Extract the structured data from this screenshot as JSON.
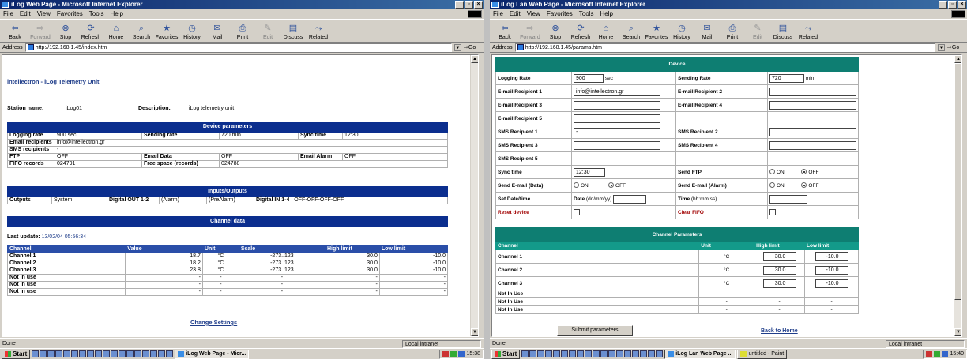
{
  "window1": {
    "title": "iLog Web Page - Microsoft Internet Explorer",
    "menu": [
      "File",
      "Edit",
      "View",
      "Favorites",
      "Tools",
      "Help"
    ],
    "toolbar": [
      {
        "label": "Back",
        "icon": "back-arrow-icon",
        "enabled": true
      },
      {
        "label": "Forward",
        "icon": "forward-arrow-icon",
        "enabled": false
      },
      {
        "label": "Stop",
        "icon": "stop-icon",
        "enabled": true
      },
      {
        "label": "Refresh",
        "icon": "refresh-icon",
        "enabled": true
      },
      {
        "label": "Home",
        "icon": "home-icon",
        "enabled": true
      },
      {
        "label": "Search",
        "icon": "search-icon",
        "enabled": true
      },
      {
        "label": "Favorites",
        "icon": "favorites-icon",
        "enabled": true
      },
      {
        "label": "History",
        "icon": "history-icon",
        "enabled": true
      },
      {
        "label": "Mail",
        "icon": "mail-icon",
        "enabled": true
      },
      {
        "label": "Print",
        "icon": "print-icon",
        "enabled": true
      },
      {
        "label": "Edit",
        "icon": "edit-icon",
        "enabled": false
      },
      {
        "label": "Discuss",
        "icon": "discuss-icon",
        "enabled": true
      },
      {
        "label": "Related",
        "icon": "related-icon",
        "enabled": true
      }
    ],
    "address_label": "Address",
    "address": "http://192.168.1.45/index.htm",
    "go_label": "Go",
    "status": "Done",
    "zone": "Local intranet",
    "page": {
      "heading": "intellectron - iLog Telemetry Unit",
      "station_label": "Station name:",
      "station_value": "iLog01",
      "desc_label": "Description:",
      "desc_value": "iLog telemetry unit",
      "device_title": "Device parameters",
      "logging_rate_label": "Logging rate",
      "logging_rate_value": "900 sec",
      "sending_rate_label": "Sending rate",
      "sending_rate_value": "720 min",
      "sync_label": "Sync time",
      "sync_value": "12:30",
      "email_recipients_label": "Email recipients",
      "email_recipients_value": "info@intellectron.gr",
      "sms_label": "SMS recipients",
      "sms_value": "-",
      "ftp_label": "FTP",
      "ftp_value": "OFF",
      "email_data_label": "Email Data",
      "email_data_value": "OFF",
      "email_alarm_label": "Email Alarm",
      "email_alarm_value": "OFF",
      "fifo_label": "FIFO records",
      "fifo_value": "024791",
      "free_label": "Free space (records)",
      "free_value": "024788",
      "io_title": "Inputs/Outputs",
      "outputs_label": "Outputs",
      "outputs_value": "System",
      "dout_label": "Digital OUT 1-2",
      "dout_v1": "(Alarm)",
      "dout_v2": "(PreAlarm)",
      "din_label": "Digital IN 1-4",
      "din_value": "OFF-OFF-OFF-OFF",
      "channel_title": "Channel data",
      "last_update_label": "Last update:",
      "last_update_value": "13/02/04 05:56:34",
      "columns": [
        "Channel",
        "Value",
        "Unit",
        "Scale",
        "High limit",
        "Low limit"
      ],
      "rows": [
        [
          "Channel 1",
          "18.7",
          "°C",
          "-273..123",
          "30.0",
          "-10.0"
        ],
        [
          "Channel 2",
          "18.2",
          "°C",
          "-273..123",
          "30.0",
          "-10.0"
        ],
        [
          "Channel 3",
          "23.8",
          "°C",
          "-273..123",
          "30.0",
          "-10.0"
        ],
        [
          "Not in use",
          "-",
          "-",
          "-",
          "-",
          "-"
        ],
        [
          "Not in use",
          "-",
          "-",
          "-",
          "-",
          "-"
        ],
        [
          "Not in use",
          "-",
          "-",
          "-",
          "-",
          "-"
        ]
      ],
      "change_link": "Change Settings"
    }
  },
  "window2": {
    "title": "iLog Lan Web Page - Microsoft Internet Explorer",
    "address": "http://192.168.1.45/params.htm",
    "status": "Done",
    "zone": "Local intranet",
    "page": {
      "device_title": "Device",
      "logging_rate_label": "Logging Rate",
      "logging_rate_value": "900",
      "logging_rate_unit": "sec",
      "sending_rate_label": "Sending Rate",
      "sending_rate_value": "720",
      "sending_rate_unit": "min",
      "email1_label": "E-mail Recipient 1",
      "email1_value": "info@intellectron.gr",
      "email2_label": "E-mail Recipient 2",
      "email3_label": "E-mail Recipient 3",
      "email4_label": "E-mail Recipient 4",
      "email5_label": "E-mail Recipient 5",
      "sms1_label": "SMS Recipient 1",
      "sms1_value": "-",
      "sms2_label": "SMS Recipient 2",
      "sms3_label": "SMS Recipient 3",
      "sms4_label": "SMS Recipient 4",
      "sms5_label": "SMS Recipient 5",
      "sync_label": "Sync time",
      "sync_value": "12:30",
      "ftp_label": "Send FTP",
      "on_label": "ON",
      "off_label": "OFF",
      "email_data_label": "Send E-mail (Data)",
      "email_alarm_label": "Send E-mail (Alarm)",
      "datetime_label": "Set Date/time",
      "date_label": "Date",
      "date_fmt": "(dd/mm/yy)",
      "time_label": "Time",
      "time_fmt": "(hh:mm:ss)",
      "reset_label": "Reset device",
      "clear_label": "Clear FIFO",
      "chan_title": "Channel Parameters",
      "columns": [
        "Channel",
        "Unit",
        "High limit",
        "Low limit"
      ],
      "rows": [
        [
          "Channel 1",
          "°C",
          "30.0",
          "-10.0"
        ],
        [
          "Channel 2",
          "°C",
          "30.0",
          "-10.0"
        ],
        [
          "Channel 3",
          "°C",
          "30.0",
          "-10.0"
        ],
        [
          "Not In Use",
          "-",
          "-",
          "-"
        ],
        [
          "Not In Use",
          "-",
          "-",
          "-"
        ],
        [
          "Not In Use",
          "-",
          "-",
          "-"
        ]
      ],
      "submit_label": "Submit parameters",
      "home_link": "Back to Home"
    }
  },
  "taskbar": {
    "start_label": "Start",
    "tasks1": [
      "iLog Web Page - Micr..."
    ],
    "tasks2": [
      "iLog Lan Web Page ...",
      "untitled - Paint"
    ],
    "clock1": "15:38",
    "clock2": "15:40"
  },
  "colors": {
    "ie_header": "#0b2e8e",
    "teal_header": "#0e7e72",
    "link": "#1f3d8a"
  }
}
